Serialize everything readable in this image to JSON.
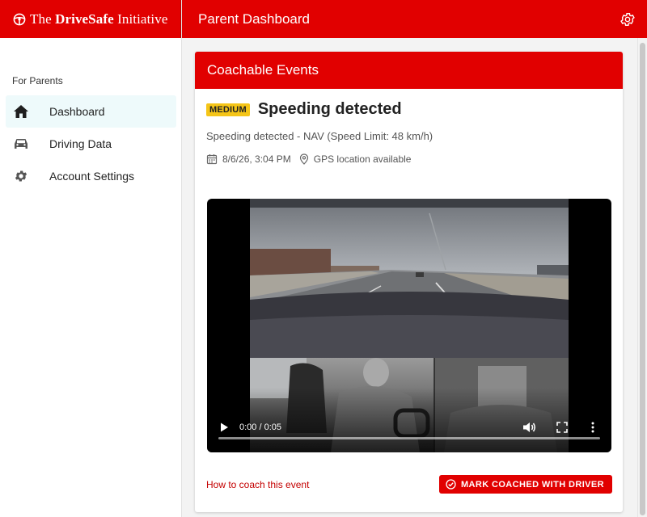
{
  "brand": {
    "prefix": "The ",
    "bold": "DriveSafe",
    "suffix": " Initiative"
  },
  "header": {
    "title": "Parent Dashboard",
    "settings_icon": "gear-icon"
  },
  "sidebar": {
    "section_label": "For Parents",
    "items": [
      {
        "label": "Dashboard",
        "icon": "home-icon",
        "active": true
      },
      {
        "label": "Driving Data",
        "icon": "car-icon",
        "active": false
      },
      {
        "label": "Account Settings",
        "icon": "gear-icon",
        "active": false
      }
    ]
  },
  "card": {
    "title": "Coachable Events",
    "event": {
      "severity": "MEDIUM",
      "title": "Speeding detected",
      "description": "Speeding detected - NAV (Speed Limit: 48 km/h)",
      "datetime": "8/6/26, 3:04 PM",
      "location": "GPS location available"
    },
    "video": {
      "time": "0:00 / 0:05",
      "progress": 0.0
    },
    "coach_link": "How to coach this event",
    "mark_button": "MARK COACHED WITH DRIVER"
  },
  "colors": {
    "brand_red": "#e10000",
    "badge_yellow": "#f5c518",
    "active_nav_bg": "#eefafb"
  }
}
